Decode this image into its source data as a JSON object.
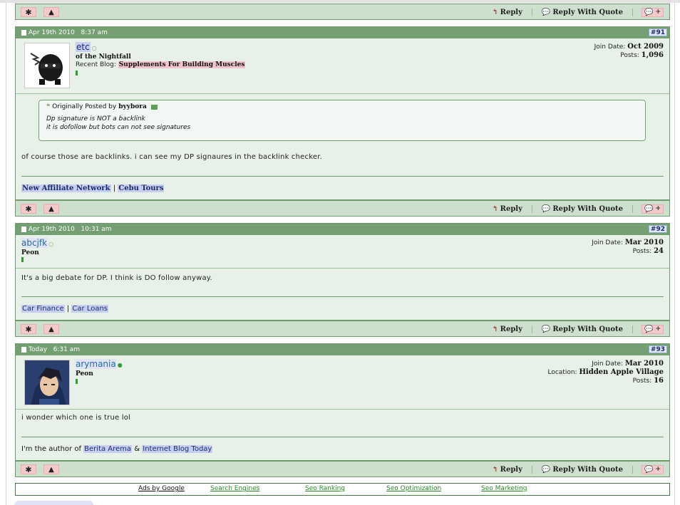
{
  "common": {
    "star": "✱",
    "warn": "▲",
    "reply": "Reply",
    "reply_quote": "Reply With Quote",
    "reply_glyph": "↰",
    "quote_glyph": "💬",
    "multi": "+"
  },
  "posts": [
    {
      "date": "Apr 19th 2010",
      "time": "8:37 am",
      "number": "#91",
      "username": "etc",
      "user_title": "of the Nightfall",
      "blog_label": "Recent Blog:",
      "blog_title": "Supplements For Building Muscles",
      "join_label": "Join Date:",
      "join_value": "Oct 2009",
      "posts_label": "Posts:",
      "posts_value": "1,096",
      "quote": {
        "label": "Originally Posted by",
        "author": "byybora",
        "line1": "Dp signature is NOT a backlink",
        "line2": "it is dofollow but bots can not see signatures"
      },
      "message": "of course those are backlinks. i can see my DP signaures in the backlink checker.",
      "sig": {
        "link1": "New Affiliate Network",
        "sep": "|",
        "link2": "Cebu Tours"
      }
    },
    {
      "date": "Apr 19th 2010",
      "time": "10:31 am",
      "number": "#92",
      "username": "abcjfk",
      "user_title": "Peon",
      "join_label": "Join Date:",
      "join_value": "Mar 2010",
      "posts_label": "Posts:",
      "posts_value": "24",
      "message": "It's a big debate for DP. I think is DO follow anyway.",
      "sig": {
        "link1": "Car Finance",
        "sep": "|",
        "link2": "Car Loans"
      }
    },
    {
      "date": "Today",
      "time": "6:31 am",
      "number": "#93",
      "username": "arymania",
      "user_title": "Peon",
      "join_label": "Join Date:",
      "join_value": "Mar 2010",
      "location_label": "Location:",
      "location_value": "Hidden Apple Village",
      "posts_label": "Posts:",
      "posts_value": "16",
      "message": "i wonder which one is true lol",
      "sig": {
        "prefix": "I'm the author of",
        "link1": "Berita Arema",
        "sep": "&",
        "link2": "Internet Blog Today"
      }
    }
  ],
  "footer": {
    "ads": "Ads by Google",
    "links": [
      "Search Engines",
      "Seo Ranking",
      "Seo Optimization",
      "Seo Marketing"
    ]
  }
}
